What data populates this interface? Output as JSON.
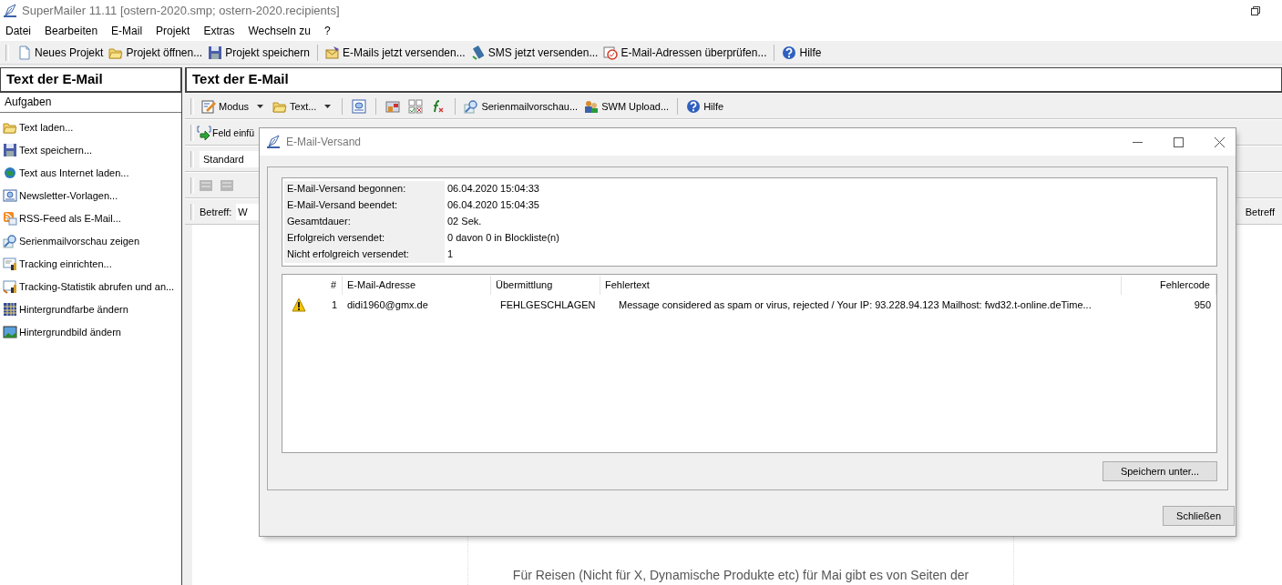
{
  "window": {
    "title": "SuperMailer 11.11 [ostern-2020.smp; ostern-2020.recipients]"
  },
  "menu": [
    "Datei",
    "Bearbeiten",
    "E-Mail",
    "Projekt",
    "Extras",
    "Wechseln zu",
    "?"
  ],
  "toolbar": [
    {
      "label": "Neues Projekt"
    },
    {
      "label": "Projekt öffnen..."
    },
    {
      "label": "Projekt speichern"
    },
    {
      "label": "E-Mails jetzt versenden..."
    },
    {
      "label": "SMS jetzt versenden..."
    },
    {
      "label": "E-Mail-Adressen überprüfen..."
    },
    {
      "label": "Hilfe"
    }
  ],
  "sidebar": {
    "title": "Text der E-Mail",
    "section": "Aufgaben",
    "items": [
      "Text laden...",
      "Text speichern...",
      "Text aus Internet laden...",
      "Newsletter-Vorlagen...",
      "RSS-Feed als E-Mail...",
      "Serienmailvorschau zeigen",
      "Tracking einrichten...",
      "Tracking-Statistik abrufen und an...",
      "Hintergrundfarbe ändern",
      "Hintergrundbild ändern"
    ]
  },
  "editor": {
    "title": "Text der E-Mail",
    "toolbar": [
      {
        "kind": "text",
        "label": "Modus",
        "dropdown": true
      },
      {
        "kind": "text",
        "label": "Text...",
        "dropdown": true
      },
      {
        "kind": "icon"
      },
      {
        "kind": "icon"
      },
      {
        "kind": "icon"
      },
      {
        "kind": "icon"
      },
      {
        "kind": "text",
        "label": "Serienmailvorschau...",
        "dropdown": false
      },
      {
        "kind": "text",
        "label": "SWM Upload...",
        "dropdown": false
      },
      {
        "kind": "text",
        "label": "Hilfe",
        "dropdown": false
      }
    ],
    "insert_field": "Feld einfü",
    "style": "Standard",
    "subject_label": "Betreff:",
    "subject_value": "W",
    "right_label": "Betreff",
    "body_lines": [
      "Für Reisen (Nicht für X, Dynamische Produkte etc) für Mai gibt es von Seiten der"
    ]
  },
  "dialog": {
    "title": "E-Mail-Versand",
    "summary": [
      {
        "label": "E-Mail-Versand begonnen:",
        "value": "06.04.2020 15:04:33"
      },
      {
        "label": "E-Mail-Versand beendet:",
        "value": "06.04.2020 15:04:35"
      },
      {
        "label": "Gesamtdauer:",
        "value": "02 Sek."
      },
      {
        "label": "Erfolgreich versendet:",
        "value": "0 davon 0 in Blockliste(n)"
      },
      {
        "label": "Nicht erfolgreich versendet:",
        "value": "1"
      }
    ],
    "columns": [
      "#",
      "E-Mail-Adresse",
      "Übermittlung",
      "Fehlertext",
      "Fehlercode"
    ],
    "rows": [
      {
        "kind": "warning",
        "cells": [
          "1",
          "didi1960@gmx.de",
          "FEHLGESCHLAGEN",
          "Message considered as spam or virus, rejected / Your IP: 93.228.94.123 Mailhost: fwd32.t-online.deTime...",
          "950"
        ]
      }
    ],
    "save_button": "Speichern unter...",
    "close_button": "Schließen"
  }
}
